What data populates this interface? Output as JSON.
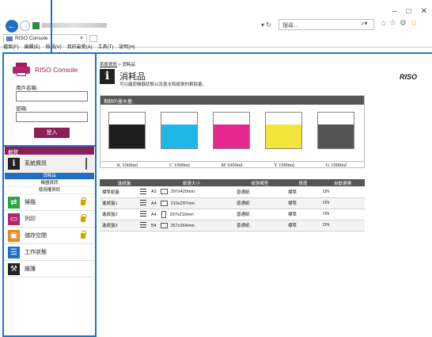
{
  "browser": {
    "window_controls": [
      "–",
      "□",
      "✕"
    ],
    "search_placeholder": "搜尋...",
    "tab_title": "RISO Console",
    "menu": [
      "檔案(F)",
      "編輯(E)",
      "檢視(V)",
      "我的最愛(A)",
      "工具(T)",
      "說明(H)"
    ]
  },
  "login": {
    "brand": "RISO Console",
    "username_label": "用戶名稱:",
    "password_label": "密碼:",
    "username_value": "",
    "password_value": "",
    "login_button": "登入"
  },
  "sidebar": {
    "header": "概覽",
    "items": [
      {
        "label": "系統資訊",
        "icon": "info-icon",
        "active": true,
        "locked": false
      },
      {
        "label": "掃描",
        "icon": "scan-icon",
        "active": false,
        "locked": true
      },
      {
        "label": "列印",
        "icon": "print-icon",
        "active": false,
        "locked": true
      },
      {
        "label": "儲存空間",
        "icon": "storage-icon",
        "active": false,
        "locked": true
      },
      {
        "label": "工作狀態",
        "icon": "job-status-icon",
        "active": false,
        "locked": false
      },
      {
        "label": "維護",
        "icon": "maintenance-icon",
        "active": false,
        "locked": false
      }
    ],
    "subitems": [
      {
        "label": "消耗品",
        "selected": true
      },
      {
        "label": "機器資訊",
        "selected": false
      },
      {
        "label": "使用權資訊",
        "selected": false
      }
    ]
  },
  "main": {
    "breadcrumb_link": "系統資訊",
    "breadcrumb_current": " > 消耗品",
    "title": "消耗品",
    "subtitle": "可以確認機器狀態以及墨水和紙張的剩餘量。",
    "brand_logo": "RISO",
    "ink_section_title": "剩餘的墨水量:",
    "inks": [
      {
        "label": "K 1000ml",
        "color": "#1e1e1e",
        "level": 0.67
      },
      {
        "label": "C 1000ml",
        "color": "#1fb7e6",
        "level": 0.67
      },
      {
        "label": "M 1000ml",
        "color": "#e5288e",
        "level": 0.67
      },
      {
        "label": "Y 1000ml",
        "color": "#f3e63a",
        "level": 0.67
      },
      {
        "label": "G 1000ml",
        "color": "#545454",
        "level": 0.67
      }
    ],
    "tray_table": {
      "headers": [
        "進紙盤",
        "紙張大小",
        "紙張類型",
        "厚度",
        "自動選擇"
      ],
      "rows": [
        {
          "tray": "標準紙盤",
          "size_name": "A3",
          "size_dims": "297x420mm",
          "orientation": "landscape",
          "type": "普通紙",
          "thickness": "標準",
          "auto": "ON"
        },
        {
          "tray": "進紙盤1",
          "size_name": "A4",
          "size_dims": "210x297mm",
          "orientation": "landscape",
          "type": "普通紙",
          "thickness": "標準",
          "auto": "ON"
        },
        {
          "tray": "進紙盤2",
          "size_name": "A4",
          "size_dims": "297x210mm",
          "orientation": "portrait",
          "type": "普通紙",
          "thickness": "標準",
          "auto": "ON"
        },
        {
          "tray": "進紙盤3",
          "size_name": "B4",
          "size_dims": "257x364mm",
          "orientation": "landscape",
          "type": "普通紙",
          "thickness": "標準",
          "auto": "ON"
        }
      ]
    }
  },
  "colors": {
    "accent": "#8c1f56",
    "highlight": "#1f73c7",
    "header_gray": "#555555",
    "selected_blue": "#1f6fc5"
  }
}
